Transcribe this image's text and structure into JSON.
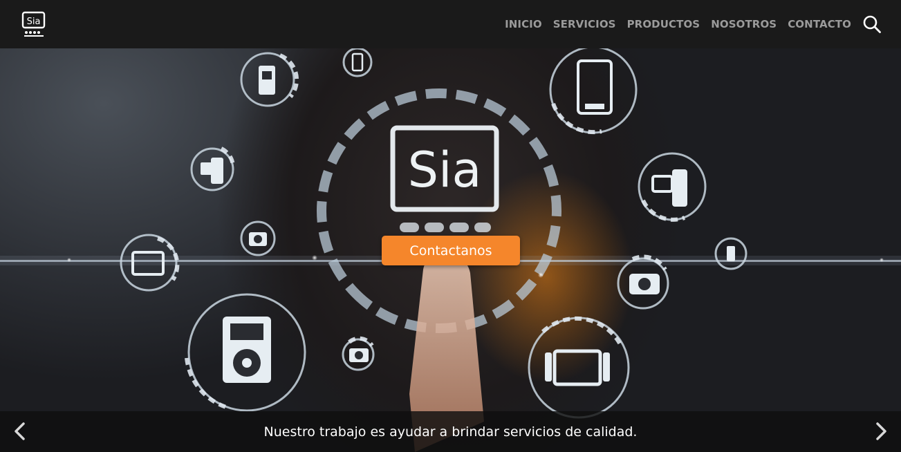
{
  "nav": {
    "logo_text": "Sia",
    "items": [
      {
        "label": "INICIO"
      },
      {
        "label": "SERVICIOS"
      },
      {
        "label": "PRODUCTOS"
      },
      {
        "label": "NOSOTROS"
      },
      {
        "label": "CONTACTO"
      }
    ],
    "search_icon": "search-icon"
  },
  "hero": {
    "logo_text": "Sia",
    "cta_label": "Contactanos",
    "accent_color": "#f5862b"
  },
  "carousel": {
    "caption": "Nuestro trabajo es ayudar a brindar servicios de calidad.",
    "prev_icon": "chevron-left-icon",
    "next_icon": "chevron-right-icon"
  }
}
